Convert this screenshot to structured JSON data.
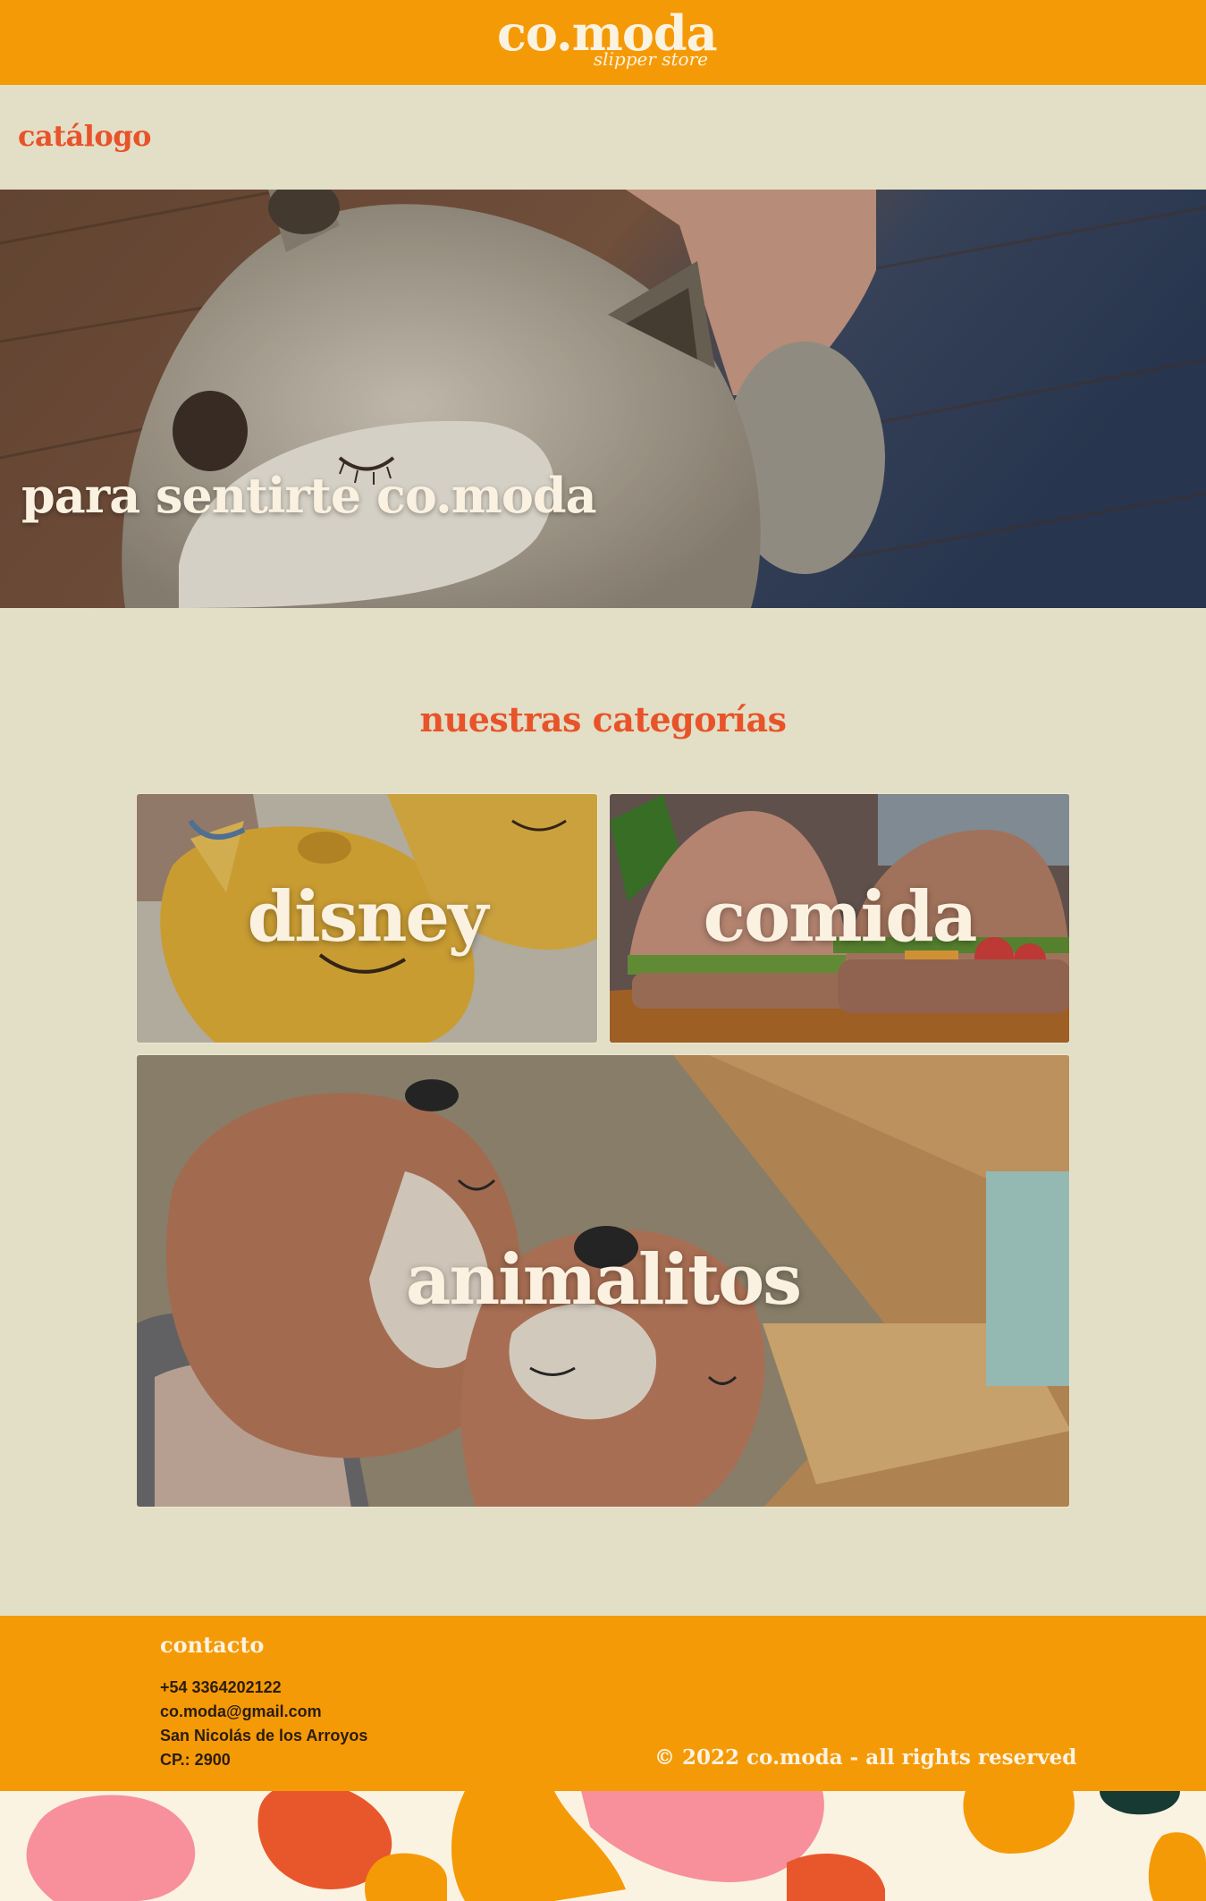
{
  "brand": {
    "name": "co.moda",
    "tagline": "slipper store"
  },
  "page": {
    "title": "catálogo"
  },
  "hero": {
    "title": "para sentirte co.moda",
    "image": "fox-slipper-photo"
  },
  "categories": {
    "title": "nuestras categorías",
    "items": [
      {
        "label": "disney",
        "image": "yellow-character-slippers-photo"
      },
      {
        "label": "comida",
        "image": "burger-slippers-photo"
      },
      {
        "label": "animalitos",
        "image": "fox-slippers-photo"
      }
    ]
  },
  "footer": {
    "contact_title": "contacto",
    "phone": "+54 3364202122",
    "email": "co.moda@gmail.com",
    "city": "San Nicolás de los Arroyos",
    "postal_code": "CP.: 2900",
    "copyright": "© 2022 co.moda - all rights reserved"
  },
  "colors": {
    "header_orange": "#f59a07",
    "accent_red": "#e8532a",
    "background_beige": "#e3dfc6",
    "cream": "#fbf3e2"
  }
}
